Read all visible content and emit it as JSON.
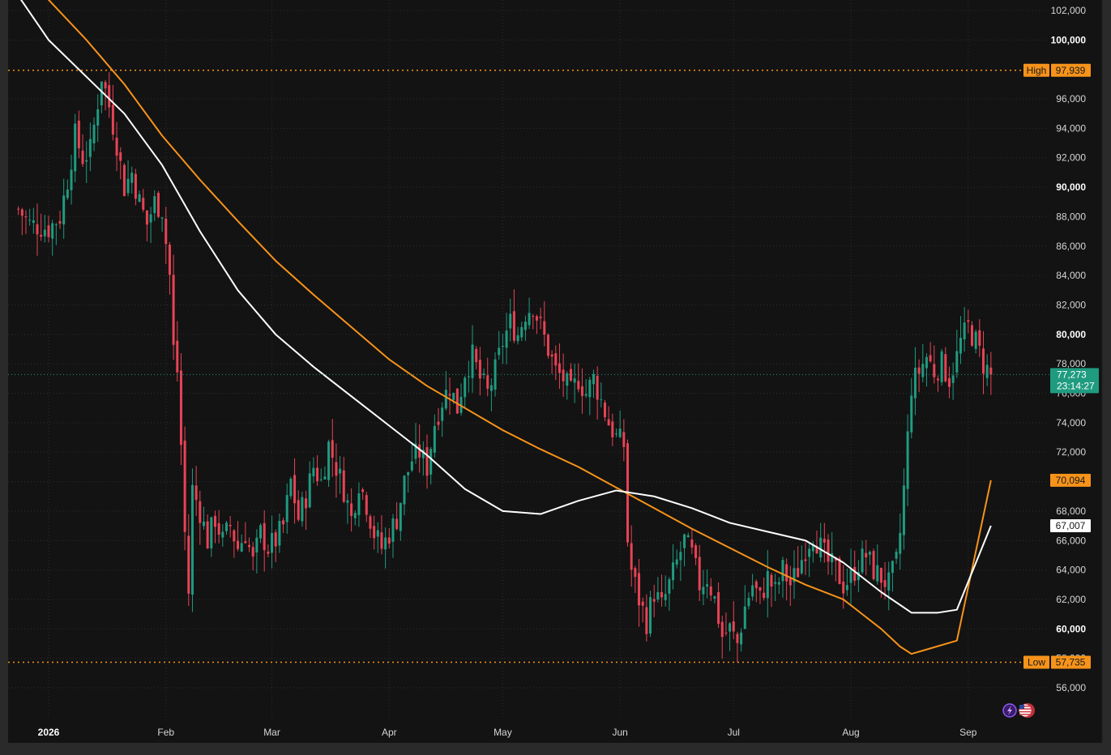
{
  "colors": {
    "background": "#131313",
    "outer": "#2a2a2a",
    "grid": "#2e2e2e",
    "up": "#1f9b80",
    "down": "#e84355",
    "ma_orange": "#f7931a",
    "ma_white": "#ffffff",
    "level_line": "#f7931a",
    "current_tag": "#1f9b80"
  },
  "chart_data": {
    "type": "candlestick",
    "title": "",
    "xlabel": "",
    "ylabel": "",
    "ylim": [
      54000,
      103000
    ],
    "y_ticks": [
      {
        "value": 56000,
        "label": "56,000",
        "bold": false
      },
      {
        "value": 58000,
        "label": "58,000",
        "bold": false
      },
      {
        "value": 60000,
        "label": "60,000",
        "bold": true
      },
      {
        "value": 62000,
        "label": "62,000",
        "bold": false
      },
      {
        "value": 64000,
        "label": "64,000",
        "bold": false
      },
      {
        "value": 66000,
        "label": "66,000",
        "bold": false
      },
      {
        "value": 68000,
        "label": "68,000",
        "bold": false
      },
      {
        "value": 70000,
        "label": "70,000",
        "bold": true
      },
      {
        "value": 72000,
        "label": "72,000",
        "bold": false
      },
      {
        "value": 74000,
        "label": "74,000",
        "bold": false
      },
      {
        "value": 76000,
        "label": "76,000",
        "bold": false
      },
      {
        "value": 78000,
        "label": "78,000",
        "bold": false
      },
      {
        "value": 80000,
        "label": "80,000",
        "bold": true
      },
      {
        "value": 82000,
        "label": "82,000",
        "bold": false
      },
      {
        "value": 84000,
        "label": "84,000",
        "bold": false
      },
      {
        "value": 86000,
        "label": "86,000",
        "bold": false
      },
      {
        "value": 88000,
        "label": "88,000",
        "bold": false
      },
      {
        "value": 90000,
        "label": "90,000",
        "bold": true
      },
      {
        "value": 92000,
        "label": "92,000",
        "bold": false
      },
      {
        "value": 94000,
        "label": "94,000",
        "bold": false
      },
      {
        "value": 96000,
        "label": "96,000",
        "bold": false
      },
      {
        "value": 100000,
        "label": "100,000",
        "bold": true
      },
      {
        "value": 102000,
        "label": "102,000",
        "bold": false
      }
    ],
    "x_ticks": [
      {
        "label": "2026",
        "bold": true,
        "day": 0
      },
      {
        "label": "Feb",
        "bold": false,
        "day": 31
      },
      {
        "label": "Mar",
        "bold": false,
        "day": 59
      },
      {
        "label": "Apr",
        "bold": false,
        "day": 90
      },
      {
        "label": "May",
        "bold": false,
        "day": 120
      },
      {
        "label": "Jun",
        "bold": false,
        "day": 151
      },
      {
        "label": "Jul",
        "bold": false,
        "day": 181
      },
      {
        "label": "Aug",
        "bold": false,
        "day": 212
      },
      {
        "label": "Sep",
        "bold": false,
        "day": 243
      }
    ],
    "high": {
      "label": "High",
      "value": 97939,
      "value_label": "97,939"
    },
    "low": {
      "label": "Low",
      "value": 57735,
      "value_label": "57,735"
    },
    "current": {
      "value": 77273,
      "value_label": "77,273",
      "countdown": "23:14:27"
    },
    "ma_orange_last": {
      "value": 70094,
      "value_label": "70,094"
    },
    "ma_white_last": {
      "value": 67007,
      "value_label": "67,007"
    },
    "close_path": [
      [
        -8,
        88500
      ],
      [
        -5,
        87500
      ],
      [
        0,
        87200
      ],
      [
        3,
        88000
      ],
      [
        5,
        90500
      ],
      [
        7,
        93500
      ],
      [
        9,
        92000
      ],
      [
        11,
        92500
      ],
      [
        13,
        95800
      ],
      [
        14,
        97600
      ],
      [
        16,
        95500
      ],
      [
        18,
        93000
      ],
      [
        20,
        90000
      ],
      [
        22,
        91000
      ],
      [
        24,
        89000
      ],
      [
        26,
        87500
      ],
      [
        28,
        89000
      ],
      [
        30,
        88500
      ],
      [
        32,
        84000
      ],
      [
        33,
        79000
      ],
      [
        34,
        77500
      ],
      [
        35,
        72500
      ],
      [
        36,
        66500
      ],
      [
        37,
        62500
      ],
      [
        38,
        69500
      ],
      [
        40,
        68000
      ],
      [
        42,
        66000
      ],
      [
        44,
        67500
      ],
      [
        46,
        66000
      ],
      [
        48,
        67000
      ],
      [
        50,
        65500
      ],
      [
        52,
        66500
      ],
      [
        54,
        64500
      ],
      [
        56,
        66500
      ],
      [
        58,
        65500
      ],
      [
        60,
        66000
      ],
      [
        62,
        67000
      ],
      [
        64,
        70000
      ],
      [
        66,
        67500
      ],
      [
        68,
        69000
      ],
      [
        70,
        71000
      ],
      [
        72,
        70000
      ],
      [
        74,
        72500
      ],
      [
        76,
        71000
      ],
      [
        78,
        69500
      ],
      [
        80,
        67500
      ],
      [
        82,
        70000
      ],
      [
        84,
        68500
      ],
      [
        86,
        66500
      ],
      [
        88,
        65500
      ],
      [
        90,
        66500
      ],
      [
        92,
        67500
      ],
      [
        94,
        70000
      ],
      [
        96,
        71500
      ],
      [
        98,
        72000
      ],
      [
        100,
        71000
      ],
      [
        102,
        74000
      ],
      [
        104,
        75500
      ],
      [
        106,
        76500
      ],
      [
        108,
        75000
      ],
      [
        110,
        77500
      ],
      [
        112,
        78500
      ],
      [
        114,
        77000
      ],
      [
        116,
        76000
      ],
      [
        118,
        77500
      ],
      [
        120,
        79500
      ],
      [
        122,
        80800
      ],
      [
        124,
        80000
      ],
      [
        126,
        81500
      ],
      [
        128,
        82000
      ],
      [
        130,
        80500
      ],
      [
        132,
        79000
      ],
      [
        134,
        77500
      ],
      [
        136,
        77000
      ],
      [
        138,
        76000
      ],
      [
        140,
        77000
      ],
      [
        142,
        76000
      ],
      [
        144,
        77000
      ],
      [
        146,
        75500
      ],
      [
        148,
        74000
      ],
      [
        150,
        73000
      ],
      [
        152,
        72500
      ],
      [
        153,
        66000
      ],
      [
        154,
        64000
      ],
      [
        156,
        62000
      ],
      [
        158,
        60500
      ],
      [
        160,
        62500
      ],
      [
        162,
        61500
      ],
      [
        164,
        63000
      ],
      [
        166,
        64500
      ],
      [
        168,
        66000
      ],
      [
        170,
        65000
      ],
      [
        172,
        63000
      ],
      [
        174,
        63500
      ],
      [
        176,
        62000
      ],
      [
        178,
        59500
      ],
      [
        180,
        60000
      ],
      [
        182,
        59000
      ],
      [
        184,
        61500
      ],
      [
        186,
        63000
      ],
      [
        188,
        62000
      ],
      [
        190,
        63500
      ],
      [
        192,
        62500
      ],
      [
        194,
        64000
      ],
      [
        196,
        63000
      ],
      [
        198,
        64000
      ],
      [
        200,
        65500
      ],
      [
        202,
        66500
      ],
      [
        204,
        65500
      ],
      [
        206,
        64500
      ],
      [
        208,
        64000
      ],
      [
        210,
        63000
      ],
      [
        212,
        63500
      ],
      [
        214,
        64500
      ],
      [
        216,
        65000
      ],
      [
        218,
        64000
      ],
      [
        220,
        63500
      ],
      [
        222,
        63000
      ],
      [
        224,
        64500
      ],
      [
        225,
        66500
      ],
      [
        226,
        69500
      ],
      [
        227,
        73000
      ],
      [
        228,
        76500
      ],
      [
        230,
        77500
      ],
      [
        232,
        78500
      ],
      [
        234,
        77500
      ],
      [
        236,
        78000
      ],
      [
        238,
        77000
      ],
      [
        240,
        78500
      ],
      [
        241,
        79500
      ],
      [
        243,
        80500
      ],
      [
        245,
        79500
      ],
      [
        247,
        78000
      ],
      [
        249,
        77273
      ]
    ],
    "ma_orange": [
      [
        -1,
        103000
      ],
      [
        10,
        100000
      ],
      [
        20,
        97000
      ],
      [
        30,
        93500
      ],
      [
        40,
        90500
      ],
      [
        50,
        87700
      ],
      [
        60,
        85000
      ],
      [
        70,
        82700
      ],
      [
        80,
        80500
      ],
      [
        90,
        78300
      ],
      [
        100,
        76500
      ],
      [
        110,
        75000
      ],
      [
        120,
        73500
      ],
      [
        130,
        72200
      ],
      [
        140,
        71000
      ],
      [
        150,
        69600
      ],
      [
        160,
        68200
      ],
      [
        170,
        66800
      ],
      [
        180,
        65500
      ],
      [
        190,
        64200
      ],
      [
        200,
        63000
      ],
      [
        210,
        62000
      ],
      [
        215,
        61000
      ],
      [
        220,
        60000
      ],
      [
        225,
        58800
      ],
      [
        228,
        58300
      ],
      [
        232,
        58600
      ],
      [
        240,
        59200
      ],
      [
        249,
        70094
      ]
    ],
    "ma_white": [
      [
        -8,
        103000
      ],
      [
        0,
        100000
      ],
      [
        10,
        97500
      ],
      [
        20,
        95000
      ],
      [
        30,
        91500
      ],
      [
        40,
        87000
      ],
      [
        50,
        83000
      ],
      [
        60,
        80000
      ],
      [
        70,
        77800
      ],
      [
        80,
        75800
      ],
      [
        90,
        73800
      ],
      [
        100,
        71800
      ],
      [
        110,
        69500
      ],
      [
        120,
        68000
      ],
      [
        130,
        67800
      ],
      [
        140,
        68700
      ],
      [
        150,
        69400
      ],
      [
        160,
        69000
      ],
      [
        170,
        68200
      ],
      [
        180,
        67200
      ],
      [
        190,
        66600
      ],
      [
        200,
        66000
      ],
      [
        210,
        64500
      ],
      [
        220,
        62500
      ],
      [
        228,
        61100
      ],
      [
        235,
        61100
      ],
      [
        240,
        61300
      ],
      [
        249,
        67007
      ]
    ]
  },
  "badges": {
    "icon1": "lightning-icon",
    "icon2": "us-flag-icon"
  }
}
